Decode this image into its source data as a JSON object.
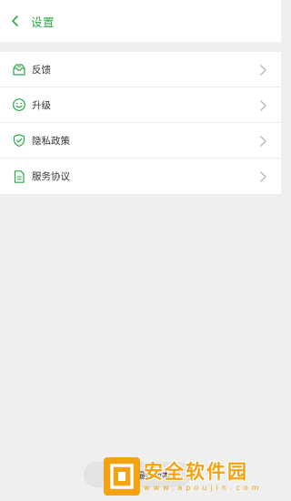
{
  "header": {
    "title": "设置",
    "back_icon": "chevron-left-icon"
  },
  "settings": {
    "items": [
      {
        "label": "反馈",
        "icon": "feedback-inbox-icon"
      },
      {
        "label": "升级",
        "icon": "smiley-upgrade-icon"
      },
      {
        "label": "隐私政策",
        "icon": "shield-check-icon"
      },
      {
        "label": "服务协议",
        "icon": "document-icon"
      }
    ]
  },
  "toast": {
    "text": "当前已是最新版本"
  },
  "watermark": {
    "main": "安全软件园",
    "sub": "www.apoujin.com"
  },
  "colors": {
    "accent": "#2aa84a",
    "background": "#efefef",
    "watermark": "#f3a312"
  }
}
